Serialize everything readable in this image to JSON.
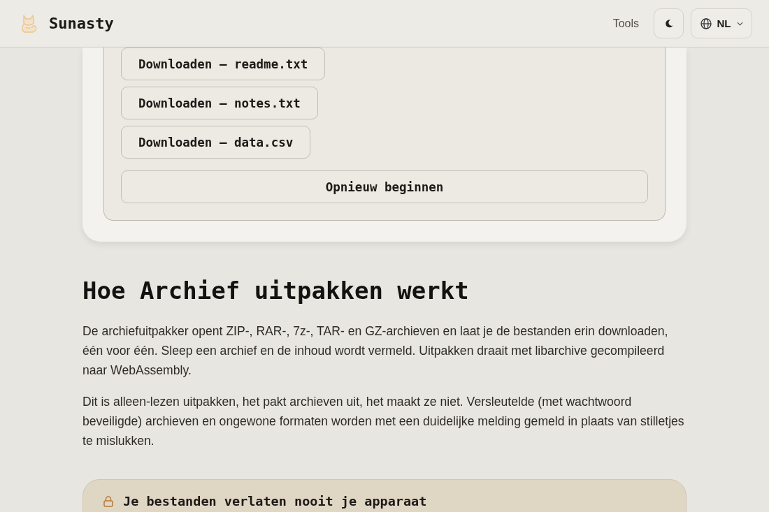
{
  "header": {
    "brand": "Sunasty",
    "nav": [
      {
        "label": "Tools"
      }
    ],
    "language": {
      "label": "NL"
    }
  },
  "result_card": {
    "downloads": [
      "Downloaden — readme.txt",
      "Downloaden — notes.txt",
      "Downloaden — data.csv"
    ],
    "restart": "Opnieuw beginnen"
  },
  "article": {
    "title": "Hoe Archief uitpakken werkt",
    "paragraphs": [
      "De archiefuitpakker opent ZIP-, RAR-, 7z-, TAR- en GZ-archieven en laat je de bestanden erin downloaden, één voor één. Sleep een archief en de inhoud wordt vermeld. Uitpakken draait met libarchive gecompileerd naar WebAssembly.",
      "Dit is alleen-lezen uitpakken, het pakt archieven uit, het maakt ze niet. Versleutelde (met wachtwoord beveiligde) archieven en ongewone formaten worden met een duidelijke melding gemeld in plaats van stilletjes te mislukken."
    ]
  },
  "callout": {
    "title": "Je bestanden verlaten nooit je apparaat"
  }
}
